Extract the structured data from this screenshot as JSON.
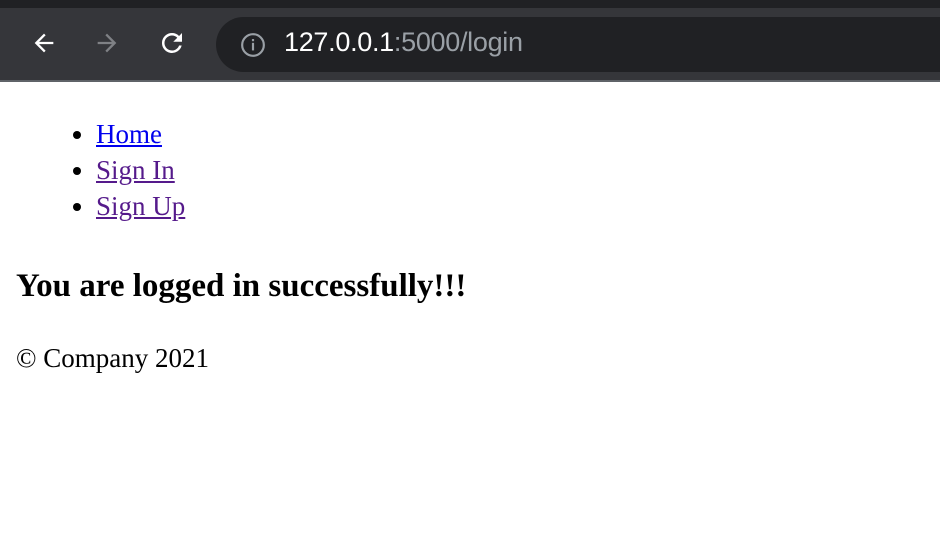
{
  "browser": {
    "url_host": "127.0.0.1",
    "url_rest": ":5000/login",
    "icons": [
      "back-arrow-icon",
      "forward-arrow-icon",
      "reload-icon",
      "info-icon"
    ]
  },
  "nav": {
    "items": [
      {
        "label": "Home",
        "visited": false
      },
      {
        "label": "Sign In",
        "visited": true
      },
      {
        "label": "Sign Up",
        "visited": true
      }
    ]
  },
  "main": {
    "message": "You are logged in successfully!!!"
  },
  "footer": {
    "text": "© Company 2021"
  },
  "colors": {
    "link": "#0000ee",
    "visited_link": "#551a8b",
    "toolbar": "#35363a",
    "omnibox": "#202124"
  }
}
